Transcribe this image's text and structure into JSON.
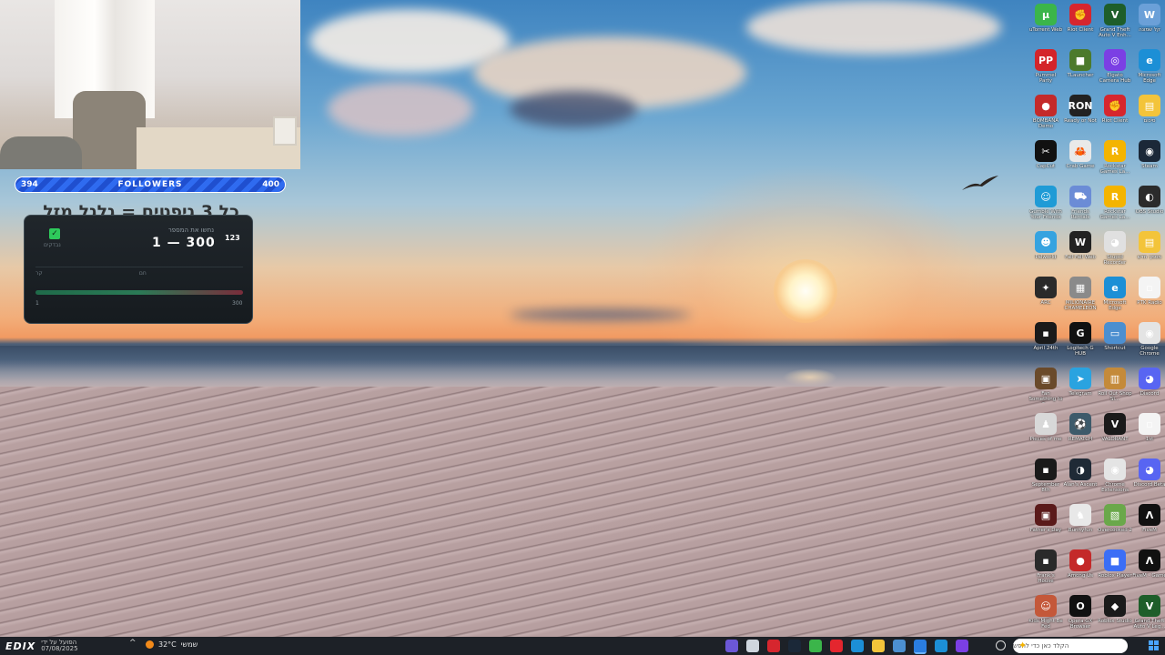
{
  "webcam": {
    "followers_start": "394",
    "followers_label": "FOLLOWERS",
    "followers_goal": "400"
  },
  "widget": {
    "title": "כל 3 גיפטים = גלגל מזל",
    "check_label": "נבדקים",
    "subtitle": "נחשו את המספר",
    "range": "1 — 300",
    "badge": "123",
    "label_left": "קר",
    "label_center": "חם",
    "min": "1",
    "max": "300"
  },
  "desktop_icons": [
    {
      "label": "uTorrent Web",
      "color": "#3bb54a",
      "glyph": "µ"
    },
    {
      "label": "Riot Client",
      "color": "#d6262e",
      "glyph": "✊"
    },
    {
      "label": "Grand Theft Auto V Enh...",
      "color": "#1e5e2a",
      "glyph": "V"
    },
    {
      "label": "קל שמונה",
      "color": "#6ba0d8",
      "glyph": "W"
    },
    {
      "label": "Pummel Party",
      "color": "#d4242a",
      "glyph": "PP"
    },
    {
      "label": "TLauncher",
      "color": "#4c7a2c",
      "glyph": "■"
    },
    {
      "label": "Elgato Camera Hub",
      "color": "#7b3fe4",
      "glyph": "◎"
    },
    {
      "label": "Microsoft Edge",
      "color": "#1c8fd6",
      "glyph": "e"
    },
    {
      "label": "BOMBANA Demo",
      "color": "#c42a2a",
      "glyph": "●"
    },
    {
      "label": "Ready or Not",
      "color": "#222222",
      "glyph": "RON"
    },
    {
      "label": "Riot Client",
      "color": "#d6262e",
      "glyph": "✊"
    },
    {
      "label": "סיכום",
      "color": "#f3c43a",
      "glyph": "▤"
    },
    {
      "label": "CapCut",
      "color": "#111111",
      "glyph": "✂"
    },
    {
      "label": "Crab Game",
      "color": "#e9e9e9",
      "glyph": "🦀"
    },
    {
      "label": "Rockstar Games La...",
      "color": "#f4b400",
      "glyph": "R"
    },
    {
      "label": "Steam",
      "color": "#1b2838",
      "glyph": "◉"
    },
    {
      "label": "Gumble With Your Friends",
      "color": "#1f9bd6",
      "glyph": "☺"
    },
    {
      "label": "Friends Rentals",
      "color": "#6b8cd6",
      "glyph": "⛟"
    },
    {
      "label": "Rockstar Games La...",
      "color": "#f4b400",
      "glyph": "R"
    },
    {
      "label": "OBS Studio",
      "color": "#2b2b2b",
      "glyph": "◐"
    },
    {
      "label": "Palworld",
      "color": "#36a3e0",
      "glyph": "☻"
    },
    {
      "label": "Fall Fall Web",
      "color": "#222222",
      "glyph": "W"
    },
    {
      "label": "Stupid Recorder",
      "color": "#e0e0e0",
      "glyph": "◕"
    },
    {
      "label": "מסמך חדש",
      "color": "#f3c43a",
      "glyph": "▤"
    },
    {
      "label": "ARC",
      "color": "#2a2a2a",
      "glyph": "✦"
    },
    {
      "label": "MILIONAIRE CHAMELEON",
      "color": "#8a8a8a",
      "glyph": "▦"
    },
    {
      "label": "Microsoft Edge",
      "color": "#1c8fd6",
      "glyph": "e"
    },
    {
      "label": "PTK Radio",
      "color": "#f4f4f4",
      "glyph": "▫"
    },
    {
      "label": "April 24th",
      "color": "#1a1a1a",
      "glyph": "▪"
    },
    {
      "label": "Logitech G HUB",
      "color": "#111111",
      "glyph": "G"
    },
    {
      "label": "Shortcut",
      "color": "#4c8fd0",
      "glyph": "▭"
    },
    {
      "label": "Google Chrome",
      "color": "#e4e4e4",
      "glyph": "◉"
    },
    {
      "label": "Fan Something to 6...",
      "color": "#6a4a2a",
      "glyph": "▣"
    },
    {
      "label": "Telegram",
      "color": "#2aa3e0",
      "glyph": "➤"
    },
    {
      "label": "Roll Out Shop Si...",
      "color": "#c48a3a",
      "glyph": "▥"
    },
    {
      "label": "Discord",
      "color": "#5865f2",
      "glyph": "◕"
    },
    {
      "label": "Pieces of me",
      "color": "#d8d8d8",
      "glyph": "♟"
    },
    {
      "label": "REMATCH",
      "color": "#3d5a6a",
      "glyph": "⚽"
    },
    {
      "label": "VALORANT",
      "color": "#1a1a1a",
      "glyph": "V"
    },
    {
      "label": "1st",
      "color": "#f4f4f4",
      "glyph": "▫"
    },
    {
      "label": "September 8th",
      "color": "#1a1a1a",
      "glyph": "▪"
    },
    {
      "label": "Alan's Ascent",
      "color": "#1f2a36",
      "glyph": "◑"
    },
    {
      "label": "Chrome Extensions",
      "color": "#e4e4e4",
      "glyph": "◉"
    },
    {
      "label": "Discord Beta",
      "color": "#5865f2",
      "glyph": "◕"
    },
    {
      "label": "Father's Day",
      "color": "#5a1a1a",
      "glyph": "▣"
    },
    {
      "label": "Bunnyfun",
      "color": "#e8e8e8",
      "glyph": "♞"
    },
    {
      "label": "Overcooked 2",
      "color": "#6aa84a",
      "glyph": "▧"
    },
    {
      "label": "FiveM",
      "color": "#111111",
      "glyph": "Λ"
    },
    {
      "label": "Frank's House",
      "color": "#2a2a2a",
      "glyph": "▪"
    },
    {
      "label": "Among Us",
      "color": "#c42a2a",
      "glyph": "●"
    },
    {
      "label": "Roblox Player",
      "color": "#3b6ef6",
      "glyph": "■"
    },
    {
      "label": "FiveM - Game",
      "color": "#111111",
      "glyph": "Λ"
    },
    {
      "label": "Kids Might Be Fed",
      "color": "#c4583a",
      "glyph": "☺"
    },
    {
      "label": "Opera GX Browser",
      "color": "#111111",
      "glyph": "O"
    },
    {
      "label": "Roblox Studio",
      "color": "#1a1a1a",
      "glyph": "◆"
    },
    {
      "label": "Grand Theft Auto V Leg...",
      "color": "#1e5e2a",
      "glyph": "V"
    }
  ],
  "taskbar": {
    "brand": "EDIX",
    "news_line1": "הפועל על ידי",
    "news_line2": "07/08/2025",
    "temperature": "32°C",
    "weather_text": "שמשי",
    "search_placeholder": "הקלד כאן כדי לחפש",
    "app_colors": [
      "#6b57d6",
      "#cfd6de",
      "#d6262e",
      "#1b2838",
      "#3bb54a",
      "#e4262e",
      "#1c8fd6",
      "#f3c43a",
      "#4c8fd0",
      "#2a7de0",
      "#1c8fd6",
      "#7b3fe4"
    ]
  }
}
